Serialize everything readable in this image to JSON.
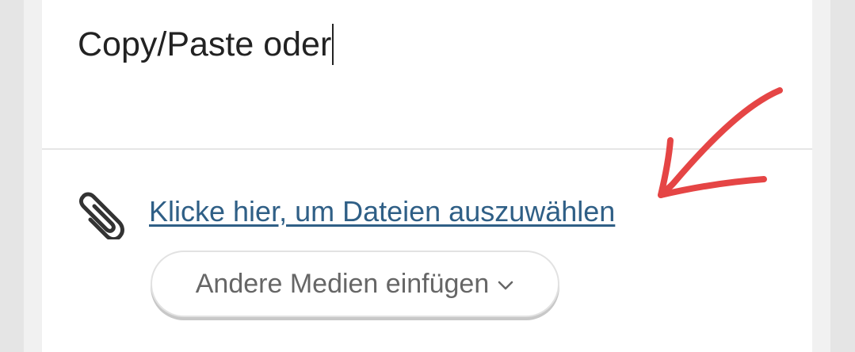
{
  "editor": {
    "text": "Copy/Paste oder"
  },
  "attachments": {
    "link_text": "Klicke hier, um Dateien auszuwählen",
    "paperclip_icon": "paperclip-icon"
  },
  "media_button": {
    "label": "Andere Medien einfügen",
    "chevron_icon": "chevron-down-icon"
  },
  "annotation": {
    "icon": "red-arrow-icon",
    "color": "#e54545"
  },
  "colors": {
    "link": "#2f5f86",
    "text": "#222222",
    "button_text": "#666666",
    "background": "#e5e5e5",
    "card": "#ffffff"
  }
}
